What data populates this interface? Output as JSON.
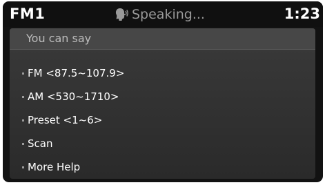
{
  "status_bar": {
    "source": "FM1",
    "status_icon": "speaking-head-icon",
    "status_text": "Speaking...",
    "clock": "1:23"
  },
  "panel": {
    "title": "You can say",
    "commands": [
      {
        "label": "FM <87.5~107.9>"
      },
      {
        "label": "AM <530~1710>"
      },
      {
        "label": "Preset <1~6>"
      },
      {
        "label": "Scan"
      },
      {
        "label": "More Help"
      }
    ]
  },
  "colors": {
    "screen_bg": "#121212",
    "panel_bg": "#333333",
    "header_bg": "#474747",
    "text_primary": "#ffffff",
    "text_muted": "#9a9a9a"
  }
}
